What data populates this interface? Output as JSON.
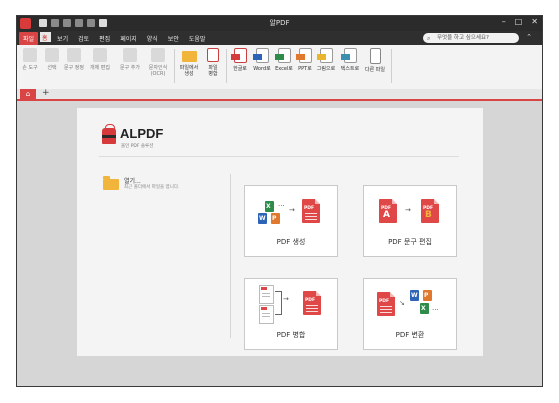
{
  "window": {
    "title": "알PDF",
    "controls": [
      "–",
      "□",
      "✕"
    ],
    "qat_icons": [
      "save-icon",
      "open-icon",
      "print-icon",
      "undo-icon",
      "redo-icon",
      "options-icon"
    ]
  },
  "menu": {
    "items": [
      {
        "label": "파일",
        "active": true
      },
      {
        "label": "홈",
        "home": true
      },
      {
        "label": "보기"
      },
      {
        "label": "검토"
      },
      {
        "label": "편집"
      },
      {
        "label": "페이지"
      },
      {
        "label": "양식"
      },
      {
        "label": "보안"
      },
      {
        "label": "도움말"
      }
    ],
    "search_placeholder": "무엇을 하고 싶으세요?",
    "collapse": "⌃"
  },
  "ribbon": {
    "tools": [
      {
        "label": "손 도구",
        "icon": "hand-icon",
        "enabled": false
      },
      {
        "label": "선택",
        "icon": "select-icon",
        "enabled": false
      },
      {
        "label": "문구 정정",
        "icon": "text-edit-icon",
        "enabled": false
      },
      {
        "label": "개체 편집",
        "icon": "object-edit-icon",
        "enabled": false
      },
      {
        "label": "문구 추가",
        "icon": "add-text-icon",
        "enabled": false
      },
      {
        "label": "문자인식\n(OCR)",
        "icon": "ocr-icon",
        "enabled": false
      },
      {
        "label": "파일에서\n생성",
        "icon": "folder-icon",
        "enabled": true
      },
      {
        "label": "파일\n병합",
        "icon": "merge-icon",
        "enabled": true
      },
      {
        "label": "한글로",
        "icon": "hwp-icon",
        "enabled": true
      },
      {
        "label": "Word로",
        "icon": "word-icon",
        "enabled": true
      },
      {
        "label": "Excel로",
        "icon": "excel-icon",
        "enabled": true
      },
      {
        "label": "PPT로",
        "icon": "ppt-icon",
        "enabled": true
      },
      {
        "label": "그림으로",
        "icon": "image-icon",
        "enabled": true
      },
      {
        "label": "텍스트로",
        "icon": "text-icon",
        "enabled": true
      },
      {
        "label": "다른 파일",
        "icon": "other-file-icon",
        "enabled": true
      }
    ]
  },
  "tabs": {
    "home_icon": "⌂",
    "add": "+"
  },
  "start": {
    "logo_name": "ALPDF",
    "logo_sub": "올인 PDF 솔루션",
    "open_title": "열기...",
    "open_desc": "최근 폴더에서 파일을 엽니다.",
    "cards": [
      {
        "label": "PDF 생성",
        "id": "create"
      },
      {
        "label": "PDF 문구 편집",
        "id": "edit"
      },
      {
        "label": "PDF 병합",
        "id": "merge"
      },
      {
        "label": "PDF 변환",
        "id": "convert"
      }
    ],
    "glyphs": {
      "pdf": "PDF",
      "x": "X",
      "w": "W",
      "p": "P",
      "a": "A",
      "b": "B",
      "dots": "...",
      "arrow": "→",
      "diag_arrow": "↘"
    }
  },
  "colors": {
    "accent": "#d94545",
    "pdf_red": "#e04848",
    "excel": "#2e8b4a",
    "word": "#2d64b8",
    "ppt": "#e0782e",
    "folder": "#f2b53b"
  }
}
